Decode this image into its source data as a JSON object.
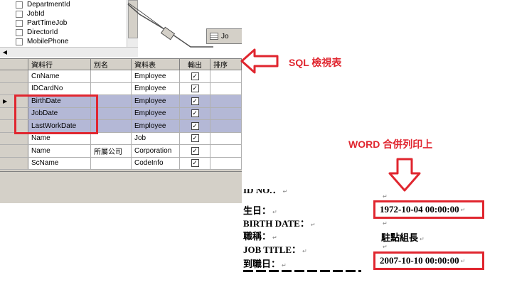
{
  "designer": {
    "field_list": [
      "DepartmentId",
      "JobId",
      "PartTimeJob",
      "DirectorId",
      "MobilePhone"
    ],
    "table_window_title": "Jo",
    "columns": [
      "資料行",
      "別名",
      "資料表",
      "輸出",
      "排序"
    ],
    "rows": [
      {
        "column": "CnName",
        "alias": "",
        "table": "Employee",
        "output": "✓",
        "selected": false
      },
      {
        "column": "IDCardNo",
        "alias": "",
        "table": "Employee",
        "output": "✓",
        "selected": false
      },
      {
        "column": "BirthDate",
        "alias": "",
        "table": "Employee",
        "output": "✓",
        "selected": true
      },
      {
        "column": "JobDate",
        "alias": "",
        "table": "Employee",
        "output": "✓",
        "selected": true
      },
      {
        "column": "LastWorkDate",
        "alias": "",
        "table": "Employee",
        "output": "✓",
        "selected": true
      },
      {
        "column": "Name",
        "alias": "",
        "table": "Job",
        "output": "✓",
        "selected": false
      },
      {
        "column": "Name",
        "alias": "所屬公司",
        "table": "Corporation",
        "output": "✓",
        "selected": false
      },
      {
        "column": "ScName",
        "alias": "",
        "table": "CodeInfo",
        "output": "✓",
        "selected": false
      }
    ],
    "current_row_marker": "▶",
    "scroll_left_arrow": "◀"
  },
  "annotations": {
    "sql_view_label": "SQL 檢視表",
    "word_merge_label": "WORD 合併列印上"
  },
  "document": {
    "lines": {
      "id_no": "ID NO.：",
      "birth_zh": "生日：",
      "birth_en": "BIRTH DATE：",
      "title_zh": "職稱：",
      "title_en": "JOB TITLE：",
      "hire_zh": "到職日："
    },
    "birth_value": "1972-10-04 00:00:00",
    "job_title_value": "駐點組長",
    "hire_value": "2007-10-10 00:00:00",
    "paragraph_mark": "↵"
  },
  "colors": {
    "highlight_red": "#e0262f",
    "selected_row": "#b4b8d6",
    "panel_gray": "#d4d0c8"
  }
}
